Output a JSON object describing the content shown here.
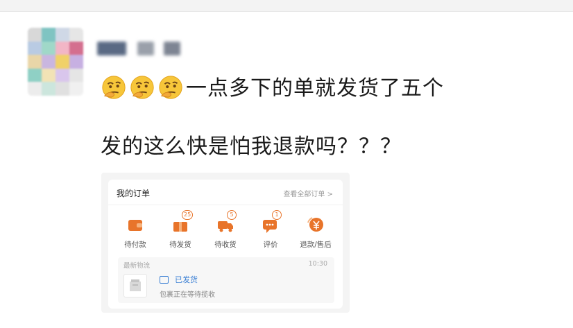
{
  "post": {
    "line1": "一点多下的单就发货了五个",
    "line2": "发的这么快是怕我退款吗？？？",
    "emojis": [
      "thinking-face-icon",
      "thinking-face-icon",
      "thinking-face-icon"
    ]
  },
  "order_card": {
    "title": "我的订单",
    "view_all": "查看全部订单 >",
    "items": [
      {
        "label": "待付款",
        "icon": "wallet-icon",
        "badge": null
      },
      {
        "label": "待发货",
        "icon": "package-icon",
        "badge": "25"
      },
      {
        "label": "待收货",
        "icon": "truck-icon",
        "badge": "5"
      },
      {
        "label": "评价",
        "icon": "comment-icon",
        "badge": "1"
      },
      {
        "label": "退款/售后",
        "icon": "refund-icon",
        "badge": null
      }
    ],
    "logistics": {
      "title": "最新物流",
      "time": "10:30",
      "status": "已发货",
      "desc": "包裹正在等待揽收"
    }
  },
  "colors": {
    "accent": "#e8742a",
    "link_blue": "#3a7fd4"
  }
}
